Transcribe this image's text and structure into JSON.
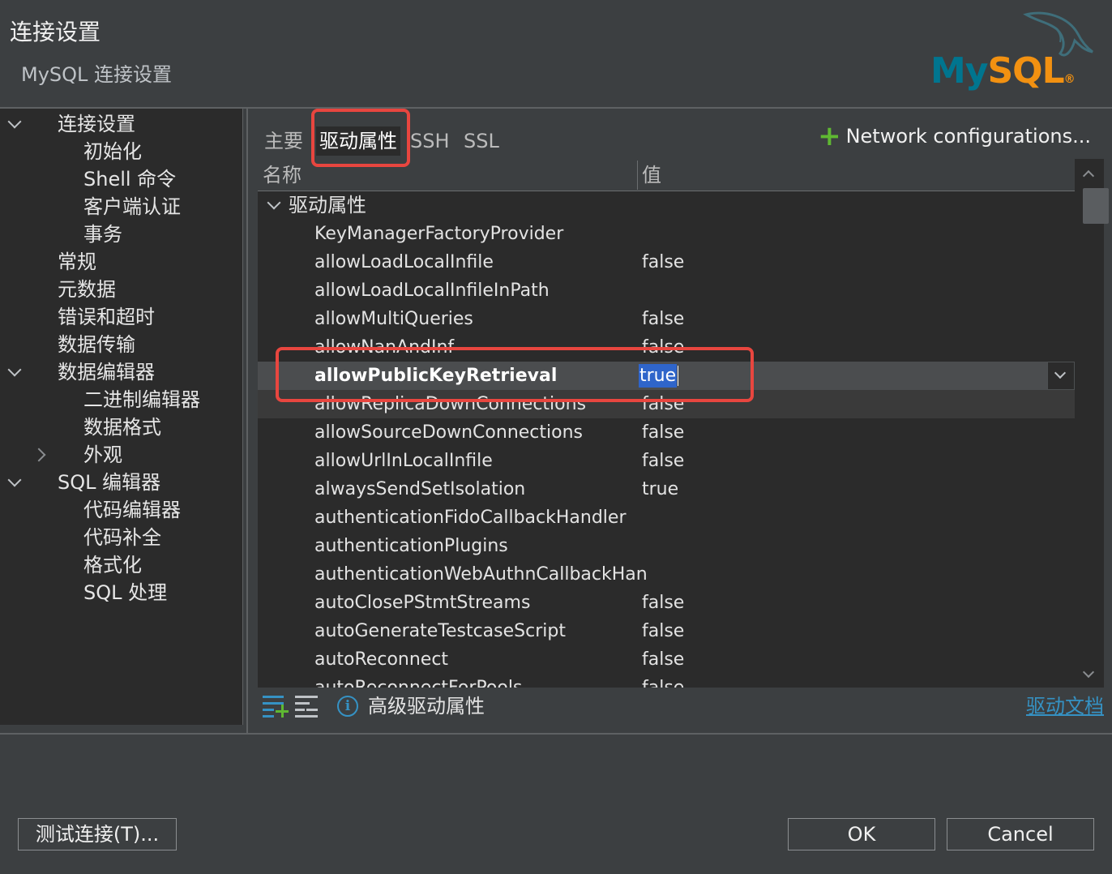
{
  "header": {
    "title": "连接设置",
    "subtitle": "MySQL 连接设置",
    "logo": {
      "my": "My",
      "sql": "SQL",
      "mark": "®"
    }
  },
  "sidebar": {
    "items": [
      {
        "label": "连接设置",
        "level": 0,
        "expander": "down"
      },
      {
        "label": "初始化",
        "level": 1
      },
      {
        "label": "Shell 命令",
        "level": 1
      },
      {
        "label": "客户端认证",
        "level": 1
      },
      {
        "label": "事务",
        "level": 1
      },
      {
        "label": "常规",
        "level": 0
      },
      {
        "label": "元数据",
        "level": 0
      },
      {
        "label": "错误和超时",
        "level": 0
      },
      {
        "label": "数据传输",
        "level": 0
      },
      {
        "label": "数据编辑器",
        "level": 0,
        "expander": "down"
      },
      {
        "label": "二进制编辑器",
        "level": 1
      },
      {
        "label": "数据格式",
        "level": 1
      },
      {
        "label": "外观",
        "level": 1,
        "expander": "right"
      },
      {
        "label": "SQL 编辑器",
        "level": 0,
        "expander": "down"
      },
      {
        "label": "代码编辑器",
        "level": 1
      },
      {
        "label": "代码补全",
        "level": 1
      },
      {
        "label": "格式化",
        "level": 1
      },
      {
        "label": "SQL 处理",
        "level": 1
      }
    ]
  },
  "tabs": [
    {
      "label": "主要"
    },
    {
      "label": "驱动属性",
      "active": true
    },
    {
      "label": "SSH"
    },
    {
      "label": "SSL"
    }
  ],
  "network_configs": {
    "icon": "plus-icon",
    "label": "Network configurations..."
  },
  "table": {
    "columns": [
      "名称",
      "值"
    ],
    "group": "驱动属性",
    "rows": [
      {
        "name": "KeyManagerFactoryProvider",
        "value": ""
      },
      {
        "name": "allowLoadLocalInfile",
        "value": "false"
      },
      {
        "name": "allowLoadLocalInfileInPath",
        "value": ""
      },
      {
        "name": "allowMultiQueries",
        "value": "false"
      },
      {
        "name": "allowNanAndInf",
        "value": "false"
      },
      {
        "name": "allowPublicKeyRetrieval",
        "value": "true",
        "selected": true
      },
      {
        "name": "allowReplicaDownConnections",
        "value": "false",
        "hover": true
      },
      {
        "name": "allowSourceDownConnections",
        "value": "false"
      },
      {
        "name": "allowUrlInLocalInfile",
        "value": "false"
      },
      {
        "name": "alwaysSendSetIsolation",
        "value": "true"
      },
      {
        "name": "authenticationFidoCallbackHandler",
        "value": ""
      },
      {
        "name": "authenticationPlugins",
        "value": ""
      },
      {
        "name": "authenticationWebAuthnCallbackHan",
        "value": ""
      },
      {
        "name": "autoClosePStmtStreams",
        "value": "false"
      },
      {
        "name": "autoGenerateTestcaseScript",
        "value": "false"
      },
      {
        "name": "autoReconnect",
        "value": "false"
      },
      {
        "name": "autoReconnectForPools",
        "value": "false"
      }
    ]
  },
  "toolbar": {
    "advanced_label": "高级驱动属性",
    "driver_doc_link": "驱动文档"
  },
  "buttons": {
    "test_connection": "测试连接(T)...",
    "ok": "OK",
    "cancel": "Cancel"
  },
  "colors": {
    "annotation": "#e8463f",
    "selection": "#2f65ca",
    "link": "#3592c4",
    "add_green": "#5fb832"
  }
}
